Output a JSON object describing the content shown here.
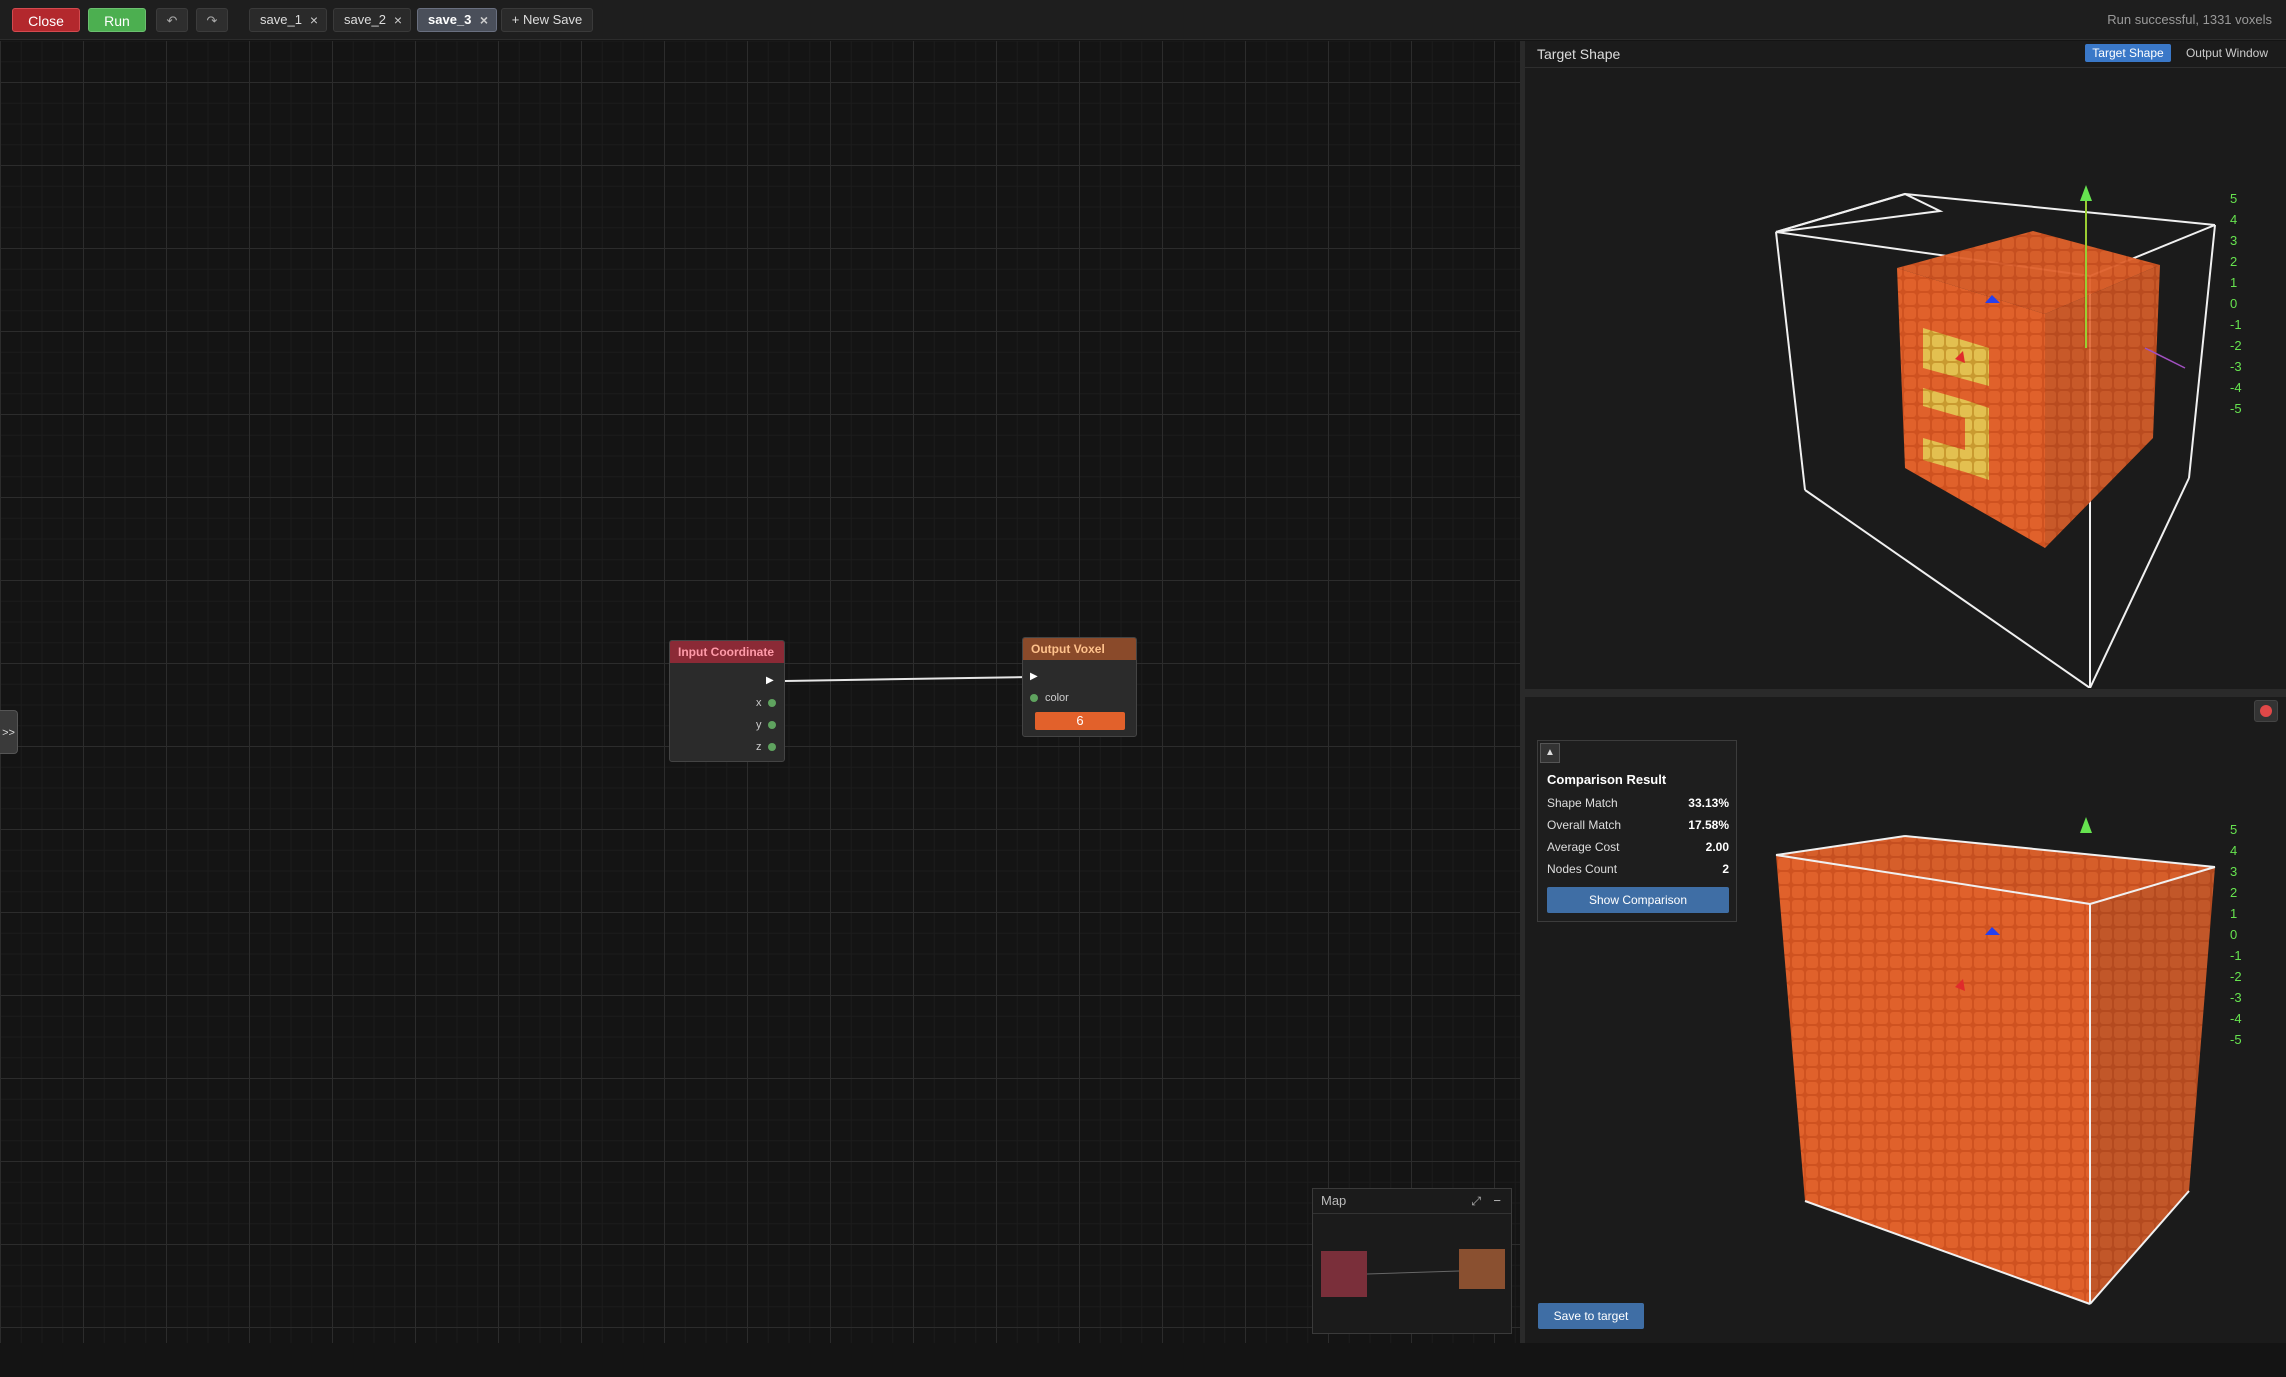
{
  "toolbar": {
    "close_label": "Close",
    "run_label": "Run",
    "undo_icon": "↶",
    "redo_icon": "↷",
    "tabs": [
      {
        "label": "save_1",
        "close": "×",
        "active": false
      },
      {
        "label": "save_2",
        "close": "×",
        "active": false
      },
      {
        "label": "save_3",
        "close": "×",
        "active": true
      }
    ],
    "new_save_label": "+ New Save",
    "status": "Run successful, 1331 voxels"
  },
  "canvas": {
    "side_toggle": ">>",
    "nodes": {
      "input": {
        "title": "Input Coordinate",
        "ports": [
          "x",
          "y",
          "z"
        ],
        "color": "#8b2a36"
      },
      "output": {
        "title": "Output Voxel",
        "port_label": "color",
        "color_value": "6",
        "color": "#8a4a2a"
      }
    },
    "minimap": {
      "title": "Map",
      "expand_icon": "⤢",
      "minimize_icon": "−"
    }
  },
  "panel": {
    "title": "Target Shape",
    "view_tabs": {
      "target": "Target Shape",
      "output": "Output Window"
    },
    "axis_ticks": [
      "5",
      "4",
      "3",
      "2",
      "1",
      "0",
      "-1",
      "-2",
      "-3",
      "-4",
      "-5"
    ],
    "comparison": {
      "collapse_icon": "▲",
      "title": "Comparison Result",
      "rows": [
        {
          "label": "Shape Match",
          "value": "33.13%"
        },
        {
          "label": "Overall Match",
          "value": "17.58%"
        },
        {
          "label": "Average Cost",
          "value": "2.00"
        },
        {
          "label": "Nodes Count",
          "value": "2"
        }
      ],
      "button": "Show Comparison"
    },
    "save_to_target": "Save to target",
    "colors": {
      "voxel": "#d2541f",
      "inner": "#e0b84a",
      "accent": "#3a78c8"
    }
  }
}
